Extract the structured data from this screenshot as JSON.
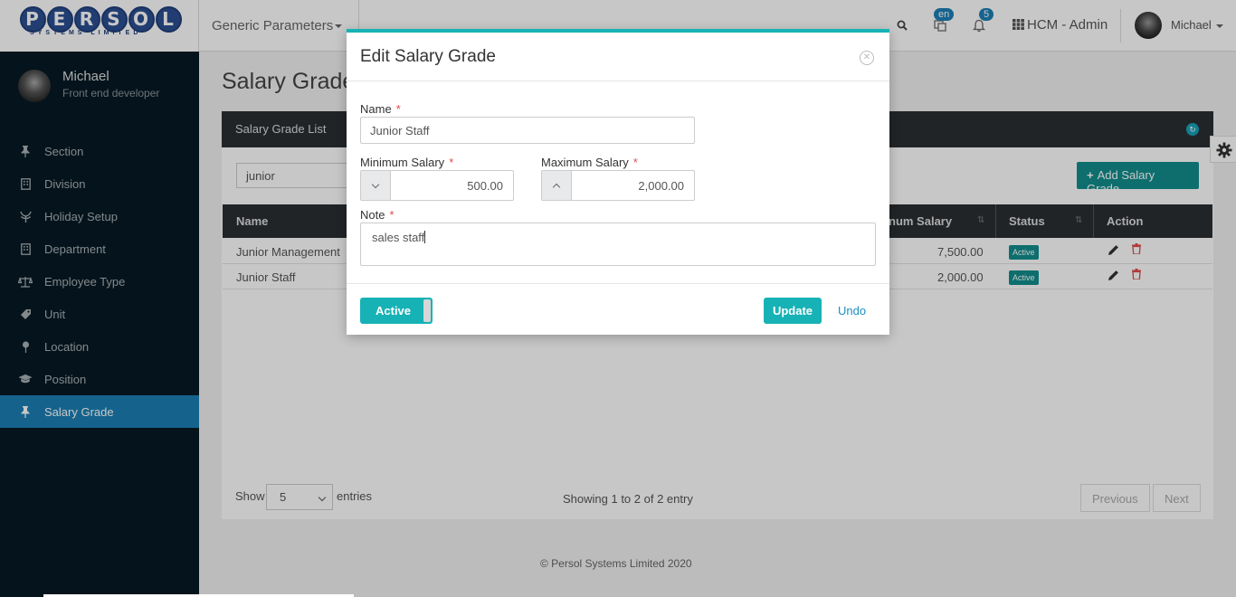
{
  "header": {
    "logo_text": "PERSOL",
    "logo_sub": "SYSTEMS LIMITED",
    "module_menu": "Generic Parameters",
    "lang_badge": "en",
    "notif_count": "5",
    "app_switcher": "HCM - Admin",
    "user": "Michael"
  },
  "sidebar": {
    "profile_name": "Michael",
    "profile_role": "Front end developer",
    "items": [
      {
        "label": "Section",
        "icon": "pin-icon"
      },
      {
        "label": "Division",
        "icon": "building-icon"
      },
      {
        "label": "Holiday Setup",
        "icon": "tree-icon"
      },
      {
        "label": "Department",
        "icon": "building-icon"
      },
      {
        "label": "Employee Type",
        "icon": "scale-icon"
      },
      {
        "label": "Unit",
        "icon": "tag-icon"
      },
      {
        "label": "Location",
        "icon": "map-pin-icon"
      },
      {
        "label": "Position",
        "icon": "graduation-cap-icon"
      },
      {
        "label": "Salary Grade",
        "icon": "pin-icon"
      }
    ],
    "active_index": 8
  },
  "page": {
    "title": "Salary Grade",
    "list_title": "Salary Grade List",
    "search_value": "junior",
    "add_button": "Add Salary Grade",
    "columns": [
      "Name",
      "num Salary",
      "Status",
      "Action"
    ],
    "rows": [
      {
        "name": "Junior Management",
        "max_salary": "7,500.00",
        "status": "Active"
      },
      {
        "name": "Junior Staff",
        "max_salary": "2,000.00",
        "status": "Active"
      }
    ],
    "show_label": "Show",
    "page_size": "5",
    "entries_label": "entries",
    "showing_text": "Showing 1 to 2 of 2 entry",
    "prev_label": "Previous",
    "next_label": "Next",
    "footer": "© Persol Systems Limited 2020"
  },
  "modal": {
    "title": "Edit Salary Grade",
    "name_label": "Name",
    "name_value": "Junior Staff",
    "min_label": "Minimum Salary",
    "min_value": "500.00",
    "max_label": "Maximum Salary",
    "max_value": "2,000.00",
    "note_label": "Note",
    "note_value": "sales staff",
    "required_mark": "*",
    "status_toggle": "Active",
    "update_button": "Update",
    "undo_button": "Undo"
  },
  "colors": {
    "accent": "#17b2b5",
    "sidebar_bg": "#071a24",
    "active_nav": "#1c7fb4",
    "dark_header": "#2b2f33"
  }
}
